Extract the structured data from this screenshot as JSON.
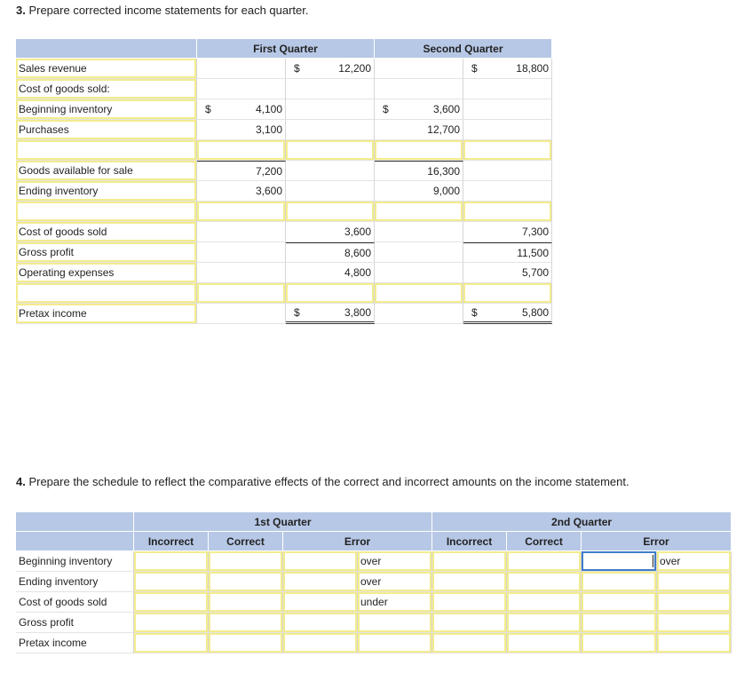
{
  "q3": {
    "number": "3.",
    "text": " Prepare corrected income statements for each quarter.",
    "headers": {
      "first": "First Quarter",
      "second": "Second Quarter"
    },
    "rows": [
      {
        "label": "Sales revenue",
        "indent": 0,
        "q1a_cur": "",
        "q1a": "",
        "q1b_cur": "$",
        "q1b": "12,200",
        "q2a_cur": "",
        "q2a": "",
        "q2b_cur": "$",
        "q2b": "18,800"
      },
      {
        "label": "Cost of goods sold:",
        "indent": 0,
        "q1a_cur": "",
        "q1a": "",
        "q1b_cur": "",
        "q1b": "",
        "q2a_cur": "",
        "q2a": "",
        "q2b_cur": "",
        "q2b": ""
      },
      {
        "label": "Beginning inventory",
        "indent": 1,
        "q1a_cur": "$",
        "q1a": "4,100",
        "q1b_cur": "",
        "q1b": "",
        "q2a_cur": "$",
        "q2a": "3,600",
        "q2b_cur": "",
        "q2b": ""
      },
      {
        "label": "Purchases",
        "indent": 1,
        "q1a_cur": "",
        "q1a": "3,100",
        "q1b_cur": "",
        "q1b": "",
        "q2a_cur": "",
        "q2a": "12,700",
        "q2b_cur": "",
        "q2b": ""
      },
      {
        "label": "",
        "indent": 0,
        "q1a_cur": "",
        "q1a": "",
        "q1b_cur": "",
        "q1b": "",
        "q2a_cur": "",
        "q2a": "",
        "q2b_cur": "",
        "q2b": ""
      },
      {
        "label": "Goods available for sale",
        "indent": 2,
        "q1a_cur": "",
        "q1a": "7,200",
        "q1b_cur": "",
        "q1b": "",
        "q2a_cur": "",
        "q2a": "16,300",
        "q2b_cur": "",
        "q2b": ""
      },
      {
        "label": "Ending inventory",
        "indent": 1,
        "q1a_cur": "",
        "q1a": "3,600",
        "q1b_cur": "",
        "q1b": "",
        "q2a_cur": "",
        "q2a": "9,000",
        "q2b_cur": "",
        "q2b": ""
      },
      {
        "label": "",
        "indent": 0,
        "q1a_cur": "",
        "q1a": "",
        "q1b_cur": "",
        "q1b": "",
        "q2a_cur": "",
        "q2a": "",
        "q2b_cur": "",
        "q2b": ""
      },
      {
        "label": "Cost of goods sold",
        "indent": 2,
        "q1a_cur": "",
        "q1a": "",
        "q1b_cur": "",
        "q1b": "3,600",
        "q2a_cur": "",
        "q2a": "",
        "q2b_cur": "",
        "q2b": "7,300"
      },
      {
        "label": "Gross profit",
        "indent": 0,
        "q1a_cur": "",
        "q1a": "",
        "q1b_cur": "",
        "q1b": "8,600",
        "q2a_cur": "",
        "q2a": "",
        "q2b_cur": "",
        "q2b": "11,500"
      },
      {
        "label": "Operating expenses",
        "indent": 0,
        "q1a_cur": "",
        "q1a": "",
        "q1b_cur": "",
        "q1b": "4,800",
        "q2a_cur": "",
        "q2a": "",
        "q2b_cur": "",
        "q2b": "5,700"
      },
      {
        "label": "",
        "indent": 0,
        "q1a_cur": "",
        "q1a": "",
        "q1b_cur": "",
        "q1b": "",
        "q2a_cur": "",
        "q2a": "",
        "q2b_cur": "",
        "q2b": ""
      },
      {
        "label": "Pretax income",
        "indent": 0,
        "q1a_cur": "",
        "q1a": "",
        "q1b_cur": "$",
        "q1b": "3,800",
        "q2a_cur": "",
        "q2a": "",
        "q2b_cur": "$",
        "q2b": "5,800"
      }
    ]
  },
  "q4": {
    "number": "4.",
    "text": " Prepare the schedule to reflect the comparative effects of the correct and incorrect amounts on the income statement.",
    "headers": {
      "first": "1st Quarter",
      "second": "2nd Quarter",
      "incorrect": "Incorrect",
      "correct": "Correct",
      "error": "Error"
    },
    "rows": [
      {
        "label": "Beginning inventory",
        "q1_incorrect": "",
        "q1_correct": "",
        "q1_error": "",
        "q1_dir": "over",
        "q2_incorrect": "",
        "q2_correct": "",
        "q2_error": "",
        "q2_dir": "over"
      },
      {
        "label": "Ending inventory",
        "q1_incorrect": "",
        "q1_correct": "",
        "q1_error": "",
        "q1_dir": "over",
        "q2_incorrect": "",
        "q2_correct": "",
        "q2_error": "",
        "q2_dir": ""
      },
      {
        "label": "Cost of goods sold",
        "q1_incorrect": "",
        "q1_correct": "",
        "q1_error": "",
        "q1_dir": "under",
        "q2_incorrect": "",
        "q2_correct": "",
        "q2_error": "",
        "q2_dir": ""
      },
      {
        "label": "Gross profit",
        "q1_incorrect": "",
        "q1_correct": "",
        "q1_error": "",
        "q1_dir": "",
        "q2_incorrect": "",
        "q2_correct": "",
        "q2_error": "",
        "q2_dir": ""
      },
      {
        "label": "Pretax income",
        "q1_incorrect": "",
        "q1_correct": "",
        "q1_error": "",
        "q1_dir": "",
        "q2_incorrect": "",
        "q2_correct": "",
        "q2_error": "",
        "q2_dir": ""
      }
    ]
  }
}
